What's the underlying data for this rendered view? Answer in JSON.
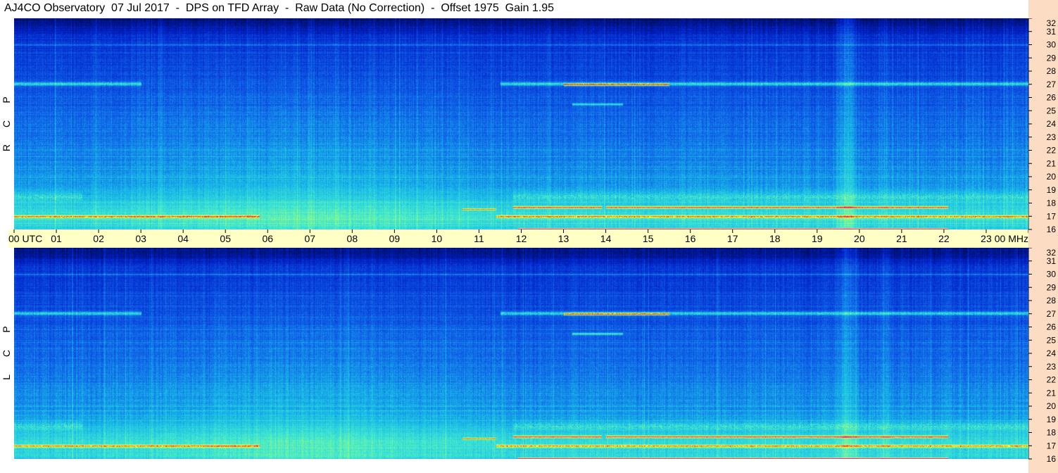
{
  "header": {
    "title": "AJ4CO Observatory  07 Jul 2017  -  DPS on TFD Array  -  Raw Data (No Correction)  -  Offset 1975  Gain 1.95"
  },
  "chart_data": [
    {
      "type": "heatmap",
      "panel_label": [
        "R",
        "C",
        "P"
      ],
      "x_unit": "UTC",
      "y_unit": "MHz",
      "x_ticks": [
        "00",
        "01",
        "02",
        "03",
        "04",
        "05",
        "06",
        "07",
        "08",
        "09",
        "10",
        "11",
        "12",
        "13",
        "14",
        "15",
        "16",
        "17",
        "18",
        "19",
        "20",
        "21",
        "22",
        "23",
        "00"
      ],
      "y_ticks": [
        16,
        17,
        18,
        19,
        20,
        21,
        22,
        23,
        24,
        25,
        26,
        27,
        28,
        29,
        30,
        31,
        32
      ],
      "xlim": [
        0,
        24
      ],
      "ylim": [
        16,
        32
      ],
      "colormap": [
        "#000a4a",
        "#0020c8",
        "#1060e8",
        "#18b8e8",
        "#40e8d0",
        "#a8ff70",
        "#ffff30",
        "#ff6000",
        "#e000e0"
      ]
    },
    {
      "type": "heatmap",
      "panel_label": [
        "L",
        "C",
        "P"
      ],
      "x_unit": "UTC",
      "y_unit": "MHz",
      "x_ticks": [
        "00",
        "01",
        "02",
        "03",
        "04",
        "05",
        "06",
        "07",
        "08",
        "09",
        "10",
        "11",
        "12",
        "13",
        "14",
        "15",
        "16",
        "17",
        "18",
        "19",
        "20",
        "21",
        "22",
        "23",
        "00"
      ],
      "y_ticks": [
        16,
        17,
        18,
        19,
        20,
        21,
        22,
        23,
        24,
        25,
        26,
        27,
        28,
        29,
        30,
        31,
        32
      ],
      "xlim": [
        0,
        24
      ],
      "ylim": [
        16,
        32
      ],
      "colormap": [
        "#000a4a",
        "#0020c8",
        "#1060e8",
        "#18b8e8",
        "#40e8d0",
        "#a8ff70",
        "#ffff30",
        "#ff6000",
        "#e000e0"
      ]
    }
  ]
}
